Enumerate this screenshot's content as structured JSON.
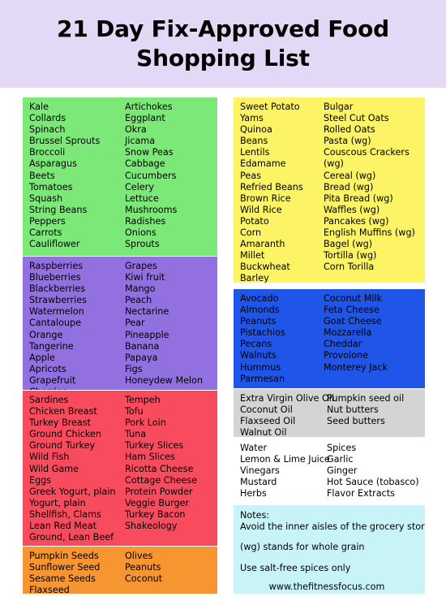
{
  "header": {
    "title_line1": "21 Day Fix-Approved Food",
    "title_line2": "Shopping List",
    "background_color": "#e4d8f7"
  },
  "blocks": {
    "vegetables": {
      "color": "#7ce878",
      "column_left": [
        "Kale",
        "Collards",
        "Spinach",
        "Brussel Sprouts",
        "Broccoli",
        "Asparagus",
        "Beets",
        "Tomatoes",
        "Squash",
        "String Beans",
        "Peppers",
        "Carrots",
        "Cauliflower"
      ],
      "column_right": [
        "Artichokes",
        "Eggplant",
        "Okra",
        "Jicama",
        "Snow Peas",
        "Cabbage",
        "Cucumbers",
        "Celery",
        "Lettuce",
        "Mushrooms",
        "Radishes",
        "Onions",
        "Sprouts"
      ]
    },
    "fruits": {
      "color": "#9370e0",
      "column_left": [
        "Raspberries",
        "Blueberries",
        "Blackberries",
        "Strawberries",
        "Watermelon",
        "Cantaloupe",
        "Orange",
        "Tangerine",
        "Apple",
        "Apricots",
        "Grapefruit",
        "Cherries"
      ],
      "column_right": [
        "Grapes",
        "Kiwi fruit",
        "Mango",
        "Peach",
        "Nectarine",
        "Pear",
        "Pineapple",
        "Banana",
        "Papaya",
        "Figs",
        "Honeydew Melon"
      ]
    },
    "proteins": {
      "color": "#f84b5e",
      "column_left": [
        "Sardines",
        "Chicken Breast",
        "Turkey Breast",
        "Ground Chicken",
        "Ground Turkey",
        "Wild Fish",
        "Wild Game",
        "Eggs",
        "Greek Yogurt, plain",
        "Yogurt, plain",
        "Shellfish, Clams",
        "Lean Red Meat",
        "Ground, Lean Beef"
      ],
      "column_right": [
        "Tempeh",
        "Tofu",
        "Pork Loin",
        "Tuna",
        "Turkey Slices",
        "Ham Slices",
        "Ricotta Cheese",
        "Cottage Cheese",
        "Protein Powder",
        "Veggie Burger",
        "Turkey Bacon",
        "Shakeology"
      ]
    },
    "seeds": {
      "color": "#f79530",
      "column_left": [
        "Pumpkin Seeds",
        "Sunflower Seed",
        "Sesame Seeds",
        "Flaxseed"
      ],
      "column_right": [
        "Olives",
        "Peanuts",
        "Coconut"
      ]
    },
    "carbs": {
      "color": "#fcf464",
      "column_left": [
        "Sweet Potato",
        "Yams",
        "Quinoa",
        "Beans",
        "Lentils",
        "Edamame",
        "Peas",
        "Refried Beans",
        "Brown Rice",
        "Wild Rice",
        "Potato",
        "Corn",
        "Amaranth",
        "Millet",
        "Buckwheat",
        "Barley"
      ],
      "column_right": [
        "Bulgar",
        "Steel Cut Oats",
        "Rolled Oats",
        "Pasta (wg)",
        "Couscous Crackers",
        "(wg)",
        "Cereal (wg)",
        "Bread (wg)",
        "Pita Bread (wg)",
        "Waffles (wg)",
        "Pancakes (wg)",
        "English Muffins (wg)",
        "Bagel (wg)",
        "Tortilla (wg)",
        "Corn Torilla"
      ]
    },
    "fats": {
      "color": "#1f55e8",
      "column_left": [
        "Avocado",
        "Almonds",
        "Peanuts",
        "Pistachios",
        "Pecans",
        "Walnuts",
        "Hummus",
        "Parmesan"
      ],
      "column_right": [
        "Coconut Milk",
        "Feta Cheese",
        "Goat Cheese",
        "Mozzarella",
        "Cheddar",
        "Provolone",
        "Monterey Jack"
      ]
    },
    "oils": {
      "color": "#d4d4d4",
      "column_left": [
        "Extra Virgin Olive Oil",
        "Coconut Oil",
        "Flaxseed Oil",
        "Walnut Oil"
      ],
      "column_right": [
        "Pumpkin seed oil",
        "Nut butters",
        "Seed butters"
      ]
    },
    "seasonings": {
      "color": "#ffffff",
      "column_left": [
        "Water",
        "Lemon & Lime Juice",
        "Vinegars",
        "Mustard",
        "Herbs"
      ],
      "column_right": [
        "Spices",
        "Garlic",
        "Ginger",
        "Hot Sauce (tobasco)",
        "Flavor Extracts"
      ]
    },
    "notes": {
      "color": "#c8f4f7",
      "heading": "Notes:",
      "line1": "Avoid the inner aisles of the grocery store",
      "line2": "(wg) stands for whole grain",
      "line3": "Use salt-free spices only",
      "url": "www.thefitnessfocus.com"
    }
  }
}
